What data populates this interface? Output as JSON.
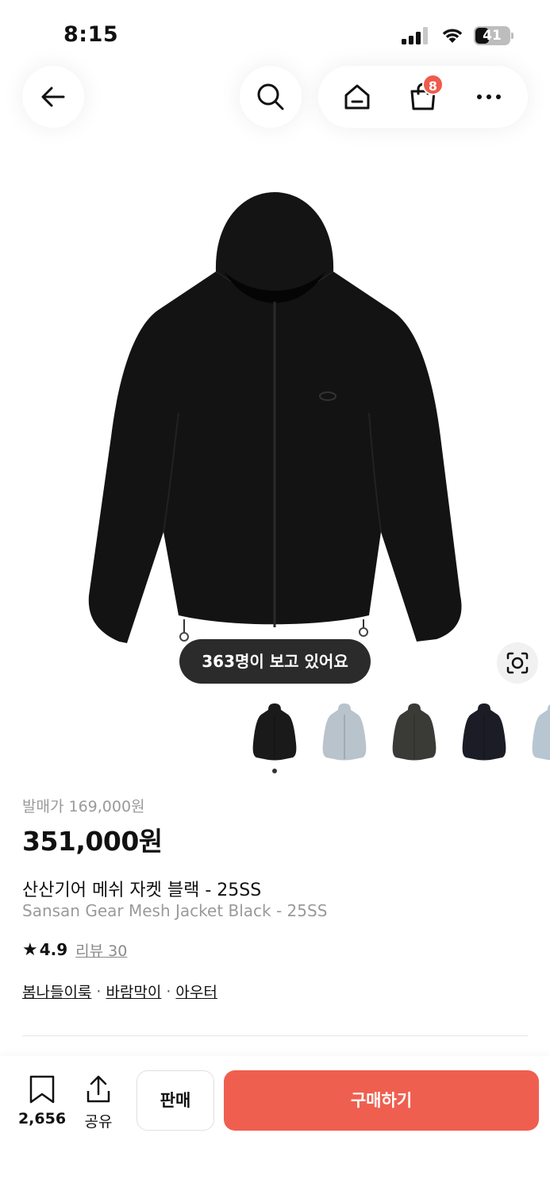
{
  "status_bar": {
    "time": "8:15",
    "battery": "41",
    "battery_level": 0.41,
    "signal_icon": "cellular-signal-icon",
    "wifi_icon": "wifi-icon"
  },
  "top_nav": {
    "back_icon": "arrow-left-icon",
    "search_icon": "search-icon",
    "home_icon": "home-icon",
    "cart_icon": "shopping-bag-icon",
    "cart_badge": "8",
    "more_icon": "more-horizontal-icon"
  },
  "hero": {
    "image": "black hooded zip-up jacket product photo",
    "viewers": "363명이 보고 있어요",
    "lens_icon": "image-search-icon"
  },
  "thumbnails": [
    {
      "name": "thumb-black",
      "color": "#1a1a1a"
    },
    {
      "name": "thumb-light-gray",
      "color": "#b9c3cc"
    },
    {
      "name": "thumb-olive",
      "color": "#3a3b36"
    },
    {
      "name": "thumb-navy",
      "color": "#1b1c25"
    },
    {
      "name": "thumb-sky",
      "color": "#b7c6d1"
    }
  ],
  "product": {
    "release_price": "발매가 169,000원",
    "price": "351,000원",
    "name_ko": "산산기어 메쉬 자켓 블랙 - 25SS",
    "name_en": "Sansan Gear Mesh Jacket Black - 25SS",
    "rating": "4.9",
    "reviews": "리뷰 30",
    "tags": [
      "봄나들이룩",
      "바람막이",
      "아우터"
    ],
    "tag_separator": "·"
  },
  "bottom_bar": {
    "bookmark_icon": "bookmark-icon",
    "bookmark_count": "2,656",
    "share_icon": "share-icon",
    "share_label": "공유",
    "sell_label": "판매",
    "buy_label": "구매하기",
    "buy_color": "#ef5f4f"
  },
  "colors": {
    "accent": "#ef5f4f",
    "badge": "#ef5b4c",
    "muted_text": "#9a9a9a"
  }
}
